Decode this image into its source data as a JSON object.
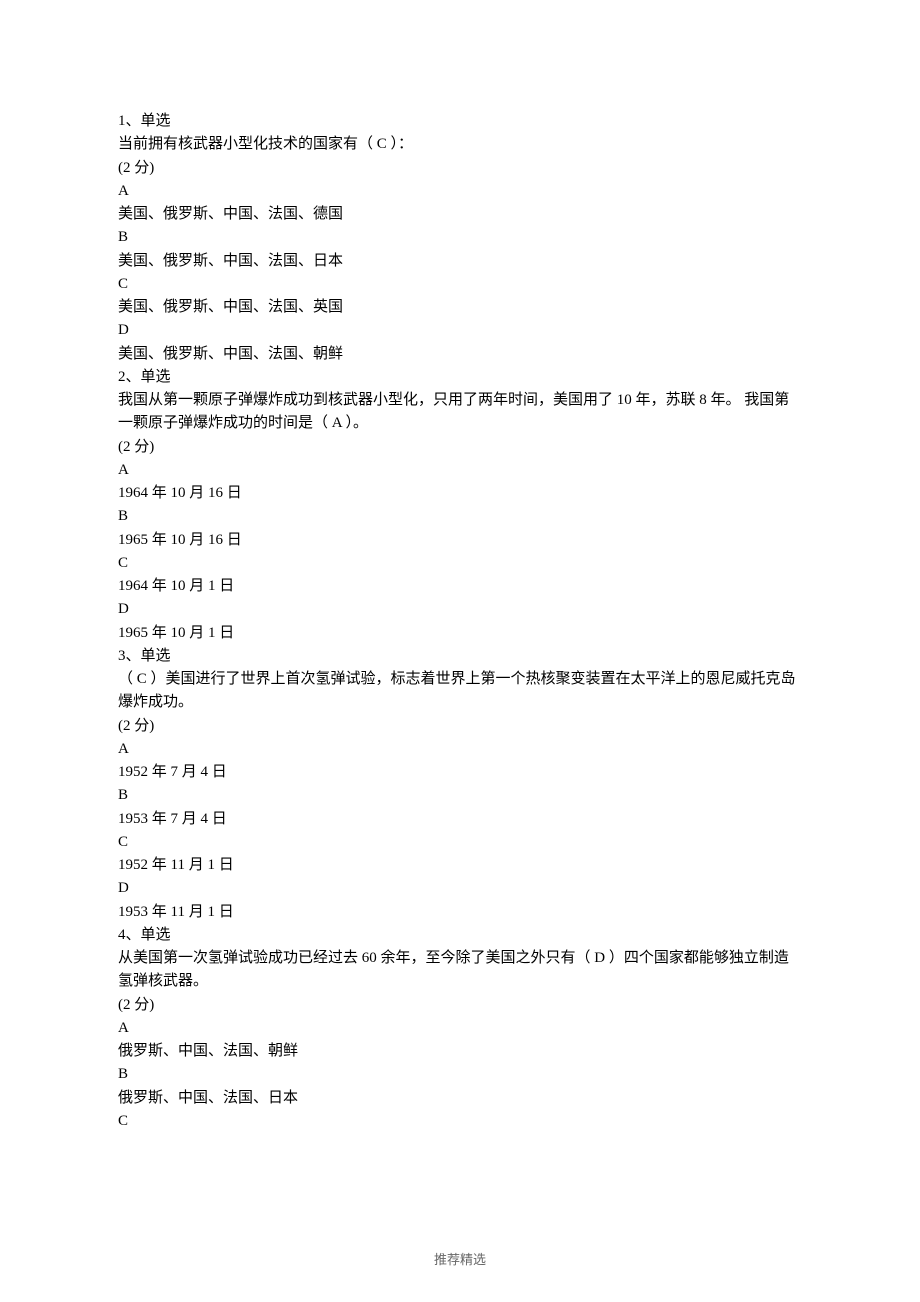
{
  "questions": [
    {
      "number": "1、单选",
      "stem": "当前拥有核武器小型化技术的国家有（ C   ）：",
      "points": "(2 分)",
      "options": [
        {
          "label": "A",
          "text": "美国、俄罗斯、中国、法国、德国"
        },
        {
          "label": "B",
          "text": "美国、俄罗斯、中国、法国、日本"
        },
        {
          "label": "C",
          "text": "美国、俄罗斯、中国、法国、英国"
        },
        {
          "label": "D",
          "text": "美国、俄罗斯、中国、法国、朝鲜"
        }
      ]
    },
    {
      "number": "2、单选",
      "stem": "我国从第一颗原子弹爆炸成功到核武器小型化，只用了两年时间，美国用了 10 年，苏联 8 年。 我国第一颗原子弹爆炸成功的时间是（  A  ）。",
      "points": "(2 分)",
      "options": [
        {
          "label": "A",
          "text": "1964 年 10 月 16 日"
        },
        {
          "label": "B",
          "text": "1965 年 10 月 16 日"
        },
        {
          "label": "C",
          "text": "1964 年 10 月 1 日"
        },
        {
          "label": "D",
          "text": "1965 年 10 月 1 日"
        }
      ]
    },
    {
      "number": "3、单选",
      "stem": "（  C  ）美国进行了世界上首次氢弹试验，标志着世界上第一个热核聚变装置在太平洋上的恩尼威托克岛爆炸成功。",
      "points": "(2 分)",
      "options": [
        {
          "label": "A",
          "text": "1952 年 7 月 4 日"
        },
        {
          "label": "B",
          "text": "1953 年 7 月 4 日"
        },
        {
          "label": "C",
          "text": "1952 年 11 月 1 日"
        },
        {
          "label": "D",
          "text": "1953 年 11 月 1 日"
        }
      ]
    },
    {
      "number": "4、单选",
      "stem": "从美国第一次氢弹试验成功已经过去 60 余年，至今除了美国之外只有（  D   ）四个国家都能够独立制造氢弹核武器。",
      "points": "(2 分)",
      "options": [
        {
          "label": "A",
          "text": "俄罗斯、中国、法国、朝鲜"
        },
        {
          "label": "B",
          "text": "俄罗斯、中国、法国、日本"
        },
        {
          "label": "C",
          "text": ""
        }
      ]
    }
  ],
  "footer": "推荐精选"
}
